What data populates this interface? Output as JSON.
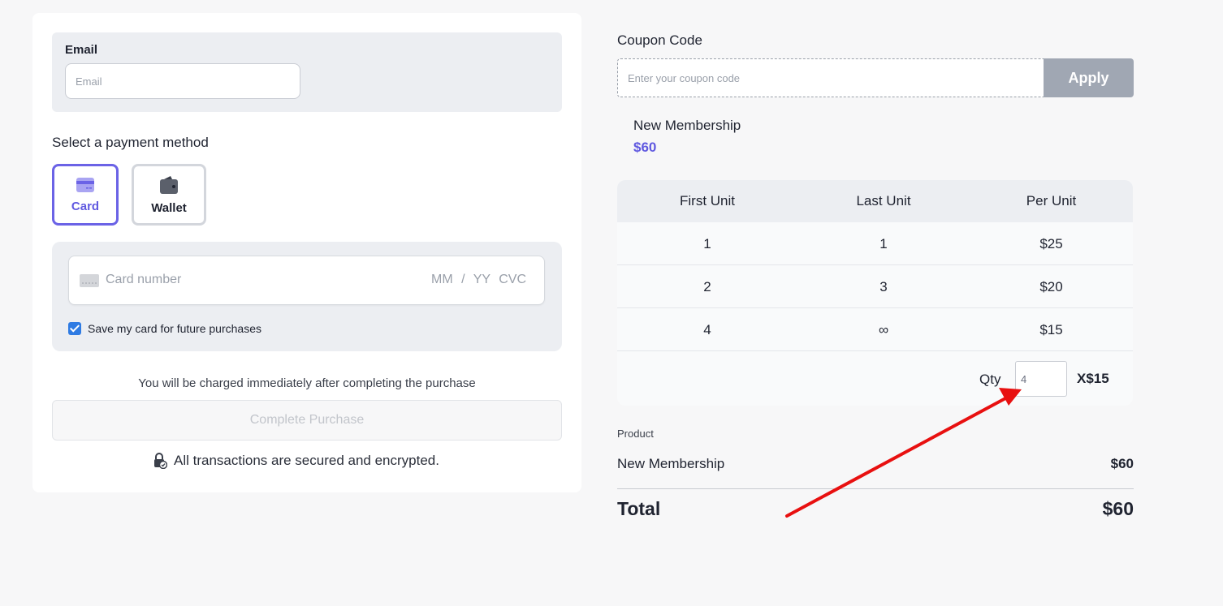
{
  "email": {
    "label": "Email",
    "placeholder": "Email",
    "value": ""
  },
  "payment": {
    "title": "Select a payment method",
    "methods": [
      {
        "label": "Card",
        "icon": "credit-card-icon",
        "selected": true
      },
      {
        "label": "Wallet",
        "icon": "wallet-icon",
        "selected": false
      }
    ],
    "card_number_placeholder": "Card number",
    "expiry_cvc_placeholder": "MM / YY  CVC",
    "save_card_label": "Save my card for future purchases",
    "save_card_checked": true
  },
  "charge_note": "You will be charged immediately after completing the purchase",
  "complete_button": "Complete Purchase",
  "secure_note": "All transactions are secured and encrypted.",
  "coupon": {
    "title": "Coupon Code",
    "placeholder": "Enter your coupon code",
    "apply_label": "Apply"
  },
  "membership": {
    "name": "New Membership",
    "price": "$60"
  },
  "tiers": {
    "headers": [
      "First Unit",
      "Last Unit",
      "Per Unit"
    ],
    "rows": [
      [
        "1",
        "1",
        "$25"
      ],
      [
        "2",
        "3",
        "$20"
      ],
      [
        "4",
        "∞",
        "$15"
      ]
    ],
    "qty_label": "Qty",
    "qty_value": "4",
    "qty_multiplier": "X$15"
  },
  "summary": {
    "product_label": "Product",
    "product_name": "New Membership",
    "product_price": "$60",
    "total_label": "Total",
    "total_price": "$60"
  },
  "colors": {
    "accent": "#6059e0",
    "checkbox": "#2f7be3",
    "apply_bg": "#a0a7b3",
    "arrow": "#e81010"
  }
}
